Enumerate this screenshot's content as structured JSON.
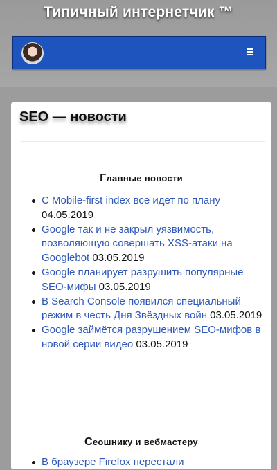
{
  "site": {
    "title": "Типичный интернетчик ™"
  },
  "page": {
    "title": "SEO — новости"
  },
  "sections": [
    {
      "heading": "Главные новости",
      "heading_first": "Г",
      "heading_rest": "лавные новости",
      "items": [
        {
          "title": "С Mobile-first index все идет по плану",
          "date": "04.05.2019"
        },
        {
          "title": "Google так и не закрыл уязвимость, позволяющую совершать XSS-атаки на Googlebot",
          "date": "03.05.2019"
        },
        {
          "title": "Google планирует разрушить популярные SEO-мифы",
          "date": "03.05.2019"
        },
        {
          "title": "В Search Console появился специальный режим в честь Дня Звёздных войн",
          "date": "03.05.2019"
        },
        {
          "title": "Google займётся разрушением SEO-мифов в новой серии видео",
          "date": "03.05.2019"
        }
      ]
    },
    {
      "heading": "Сеошнику и вебмастеру",
      "heading_first": "С",
      "heading_rest": "еошнику и вебмастеру",
      "items": [
        {
          "title": "В браузере Firefox перестали",
          "date": ""
        }
      ]
    }
  ]
}
